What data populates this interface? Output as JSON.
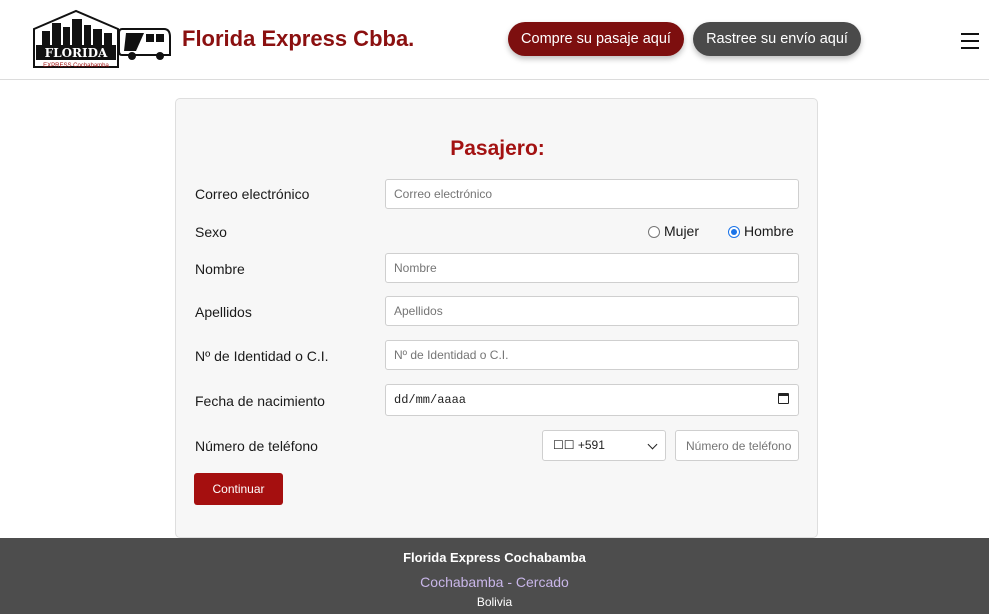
{
  "header": {
    "brand_title": "Florida Express Cbba.",
    "logo_text": "FLORIDA",
    "logo_subtext": "EXPRESS Cochabamba",
    "buy_ticket_label": "Compre su pasaje aquí",
    "track_shipment_label": "Rastree su envío aquí",
    "menu_icon": "hamburger-icon"
  },
  "form": {
    "title": "Pasajero:",
    "email": {
      "label": "Correo electrónico",
      "placeholder": "Correo electrónico",
      "value": ""
    },
    "sex": {
      "label": "Sexo",
      "options": [
        {
          "label": "Mujer",
          "selected": false
        },
        {
          "label": "Hombre",
          "selected": true
        }
      ]
    },
    "first_name": {
      "label": "Nombre",
      "placeholder": "Nombre",
      "value": ""
    },
    "last_name": {
      "label": "Apellidos",
      "placeholder": "Apellidos",
      "value": ""
    },
    "id_number": {
      "label": "Nº de Identidad o C.I.",
      "placeholder": "Nº de Identidad o C.I.",
      "value": ""
    },
    "birth_date": {
      "label": "Fecha de nacimiento",
      "placeholder": "dd/mm/aaaa"
    },
    "phone": {
      "label": "Número de teléfono",
      "country_code": "☐☐ +591",
      "placeholder": "Número de teléfono"
    },
    "continue_label": "Continuar"
  },
  "footer": {
    "title": "Florida Express Cochabamba",
    "location_link": "Cochabamba - Cercado",
    "country": "Bolivia"
  },
  "colors": {
    "brand_red": "#8b1010",
    "button_red": "#a50f0f",
    "dark_gray": "#4a4a4a",
    "footer_bg": "#4d4d4d",
    "radio_blue": "#1a73e8"
  }
}
